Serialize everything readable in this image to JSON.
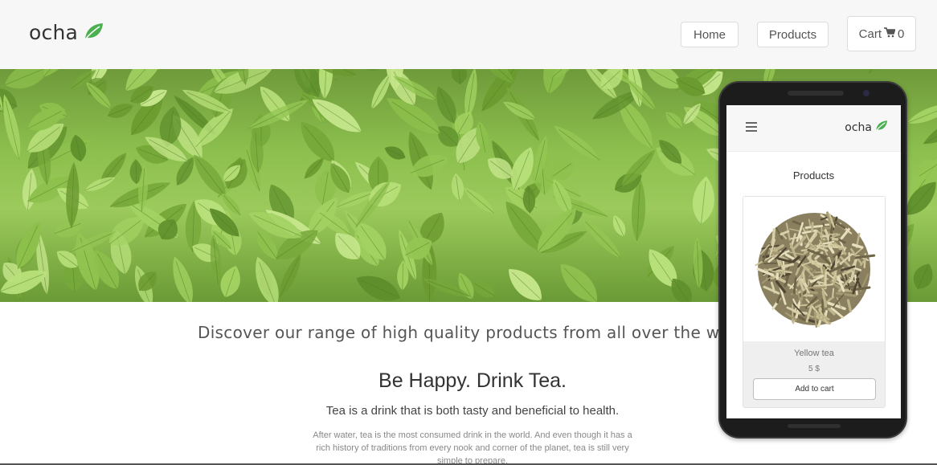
{
  "brand": {
    "name": "ocha",
    "icon": "leaf-icon",
    "accent": "#4caf50"
  },
  "nav": {
    "home_label": "Home",
    "products_label": "Products",
    "cart_label": "Cart",
    "cart_icon": "cart-icon",
    "cart_count": "0"
  },
  "hero": {
    "image": "tea-leaves-photo"
  },
  "intro": {
    "tagline": "Discover our range of high quality products from all over the wo",
    "headline": "Be Happy. Drink Tea.",
    "subhead": "Tea is a drink that is both tasty and beneficial to health.",
    "body": "After water, tea is the most consumed drink in the world. And even though it has a rich history of traditions from every nook and corner of the planet, tea is still very simple to prepare."
  },
  "mobile": {
    "brand": "ocha",
    "menu_icon": "hamburger-icon",
    "section_title": "Products",
    "product": {
      "name": "Yellow tea",
      "price": "5 $",
      "button_label": "Add to cart",
      "image": "loose-tea-leaves-photo"
    }
  }
}
